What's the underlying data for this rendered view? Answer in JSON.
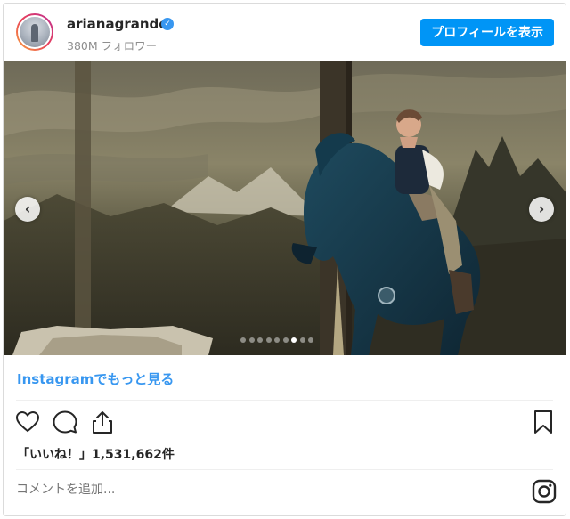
{
  "post": {
    "username": "arianagrande",
    "followers": "380M フォロワー",
    "profile_button": "プロフィールを表示",
    "verified_icon": "verified-check-icon"
  },
  "media": {
    "carousel": {
      "count": 9,
      "active_index": 6
    }
  },
  "links": {
    "more_on_instagram": "Instagramでもっと見る"
  },
  "stats": {
    "likes": "「いいね！」1,531,662件"
  },
  "comment": {
    "placeholder": "コメントを追加..."
  },
  "colors": {
    "accent": "#0095f6",
    "link": "#3897f0",
    "muted": "#8e8e8e"
  }
}
